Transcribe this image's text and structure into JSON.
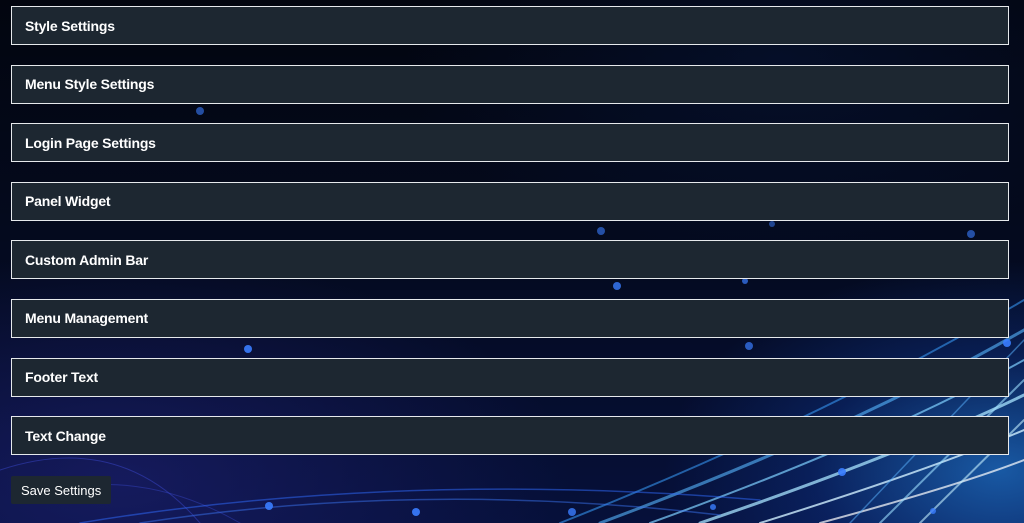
{
  "panels": [
    {
      "title": "Style Settings"
    },
    {
      "title": "Menu Style Settings"
    },
    {
      "title": "Login Page Settings"
    },
    {
      "title": "Panel Widget"
    },
    {
      "title": "Custom Admin Bar"
    },
    {
      "title": "Menu Management"
    },
    {
      "title": "Footer Text"
    },
    {
      "title": "Text Change"
    }
  ],
  "actions": {
    "save_label": "Save Settings"
  },
  "colors": {
    "panel_background": "#1d2731",
    "panel_border": "#e6e9ec",
    "text": "#ffffff",
    "background_accent": "#2a8cff"
  }
}
